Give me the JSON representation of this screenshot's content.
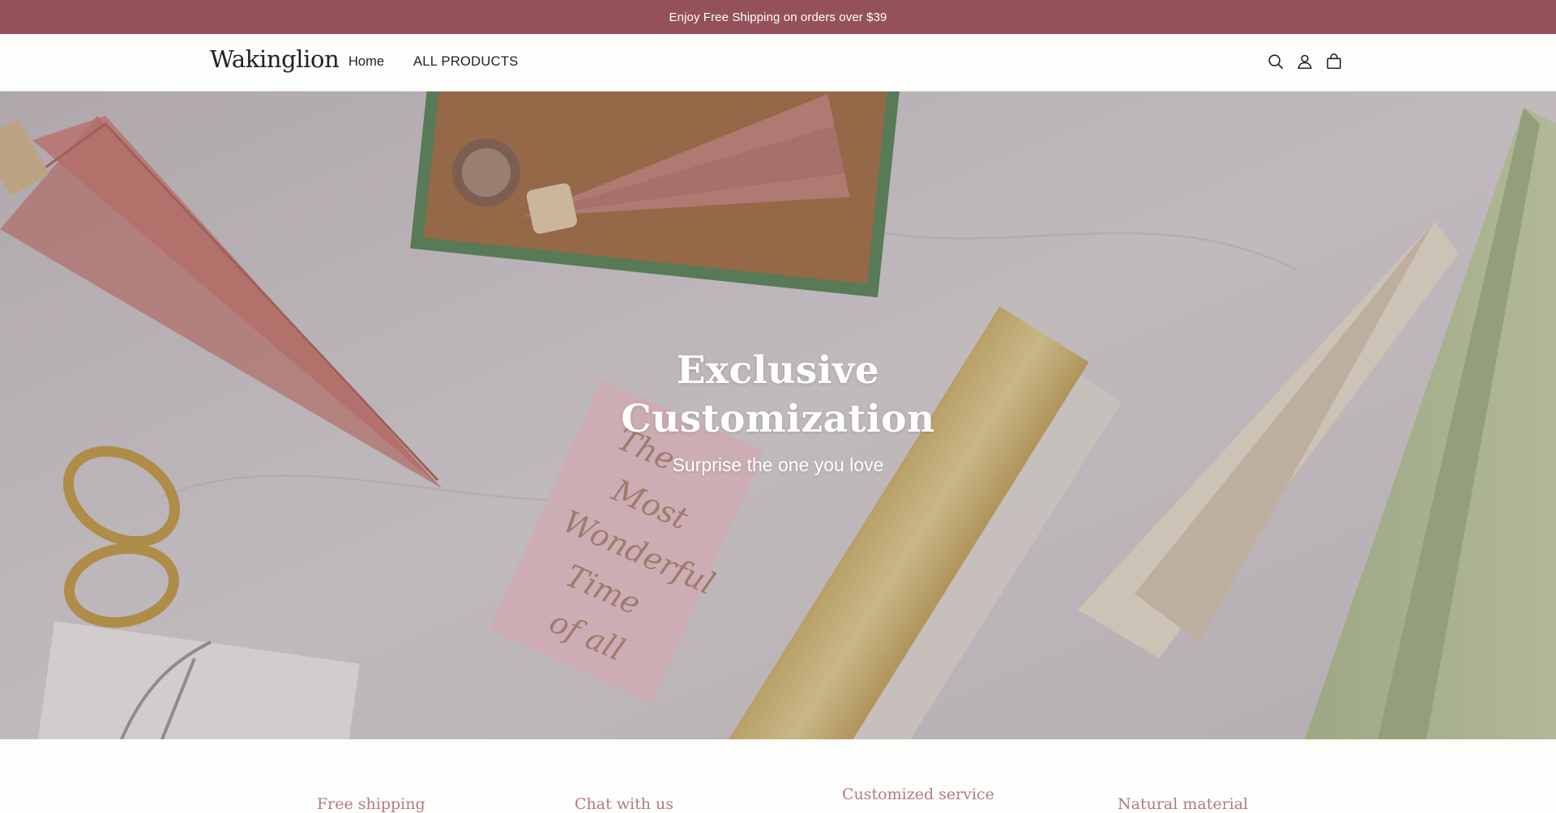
{
  "announcement": {
    "text": "Enjoy Free Shipping on orders over $39"
  },
  "header": {
    "logo": "Wakinglion",
    "nav": [
      {
        "label": "Home"
      },
      {
        "label": "ALL PRODUCTS"
      }
    ],
    "icons": [
      "search-icon",
      "account-icon",
      "cart-icon"
    ]
  },
  "hero": {
    "title_line1": "Exclusive",
    "title_line2": "Customization",
    "subtitle": "Surprise the one you love",
    "image_text": [
      "The",
      "Most",
      "Wonderful",
      "Time",
      "of all"
    ]
  },
  "features": [
    {
      "label": "Free shipping"
    },
    {
      "label": "Chat with us"
    },
    {
      "label": "Customized service"
    },
    {
      "label": "Natural material"
    }
  ],
  "colors": {
    "announcement_bg": "#955159",
    "accent_text": "#b57a85",
    "page_bg": "#fdfdfb"
  }
}
